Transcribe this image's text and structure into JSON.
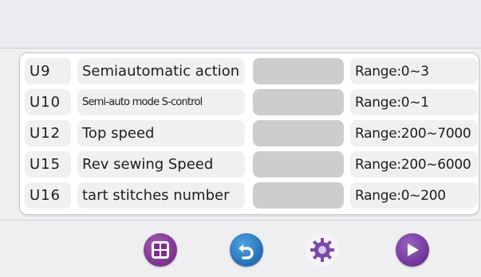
{
  "params": [
    {
      "code": "U9",
      "name": "Semiautomatic action",
      "range": "Range:0~3"
    },
    {
      "code": "U10",
      "name": "Semi-auto mode S-control",
      "range": "Range:0~1"
    },
    {
      "code": "U12",
      "name": "Top speed",
      "range": "Range:200~7000"
    },
    {
      "code": "U15",
      "name": " Rev sewing Speed",
      "range": "Range:200~6000"
    },
    {
      "code": "U16",
      "name": " tart stitches number",
      "range": "Range:0~200"
    }
  ],
  "buttons": [
    {
      "icon": "grid-menu-icon",
      "color": "#7d2d8e"
    },
    {
      "icon": "back-arrow-icon",
      "color": "#1f6fc0"
    },
    {
      "icon": "gear-icon",
      "color": "#6a38a0"
    },
    {
      "icon": "play-right-icon",
      "color": "#6a2f95"
    }
  ]
}
